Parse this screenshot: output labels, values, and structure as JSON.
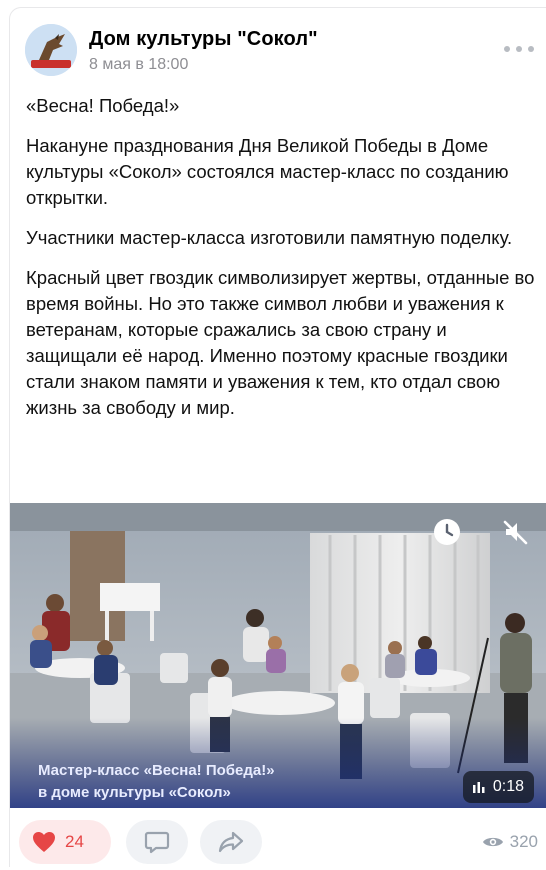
{
  "post": {
    "author": "Дом культуры \"Сокол\"",
    "date": "8 мая в 18:00",
    "paragraphs": [
      "«Весна! Победа!»",
      "Накануне празднования Дня Великой Победы в Доме культуры «Сокол» состоялся мастер-класс по созданию открытки.",
      "Участники мастер-класса изготовили памятную поделку.",
      "Красный цвет гвоздик символизирует жертвы, отданные во время войны. Но это также символ любви и уважения к ветеранам, которые сражались за свою страну и защищали её народ. Именно поэтому красные гвоздики стали знаком памяти и уважения к тем, кто отдал свою жизнь за свободу и мир."
    ]
  },
  "video": {
    "caption_line1": "Мастер-класс «Весна! Победа!»",
    "caption_line2": "в доме культуры «Сокол»",
    "duration": "0:18"
  },
  "actions": {
    "likes": "24",
    "views": "320"
  },
  "icons": {
    "avatar": "falcon-logo",
    "more": "more-dots-icon",
    "clock": "clock-icon",
    "mute": "mute-icon",
    "like": "heart-icon",
    "comment": "comment-icon",
    "share": "share-icon",
    "views": "eye-icon"
  },
  "colors": {
    "like_red": "#e64646",
    "like_bg": "#fde9ea",
    "secondary_gray": "#99a2ad",
    "button_bg": "#f0f2f5"
  }
}
